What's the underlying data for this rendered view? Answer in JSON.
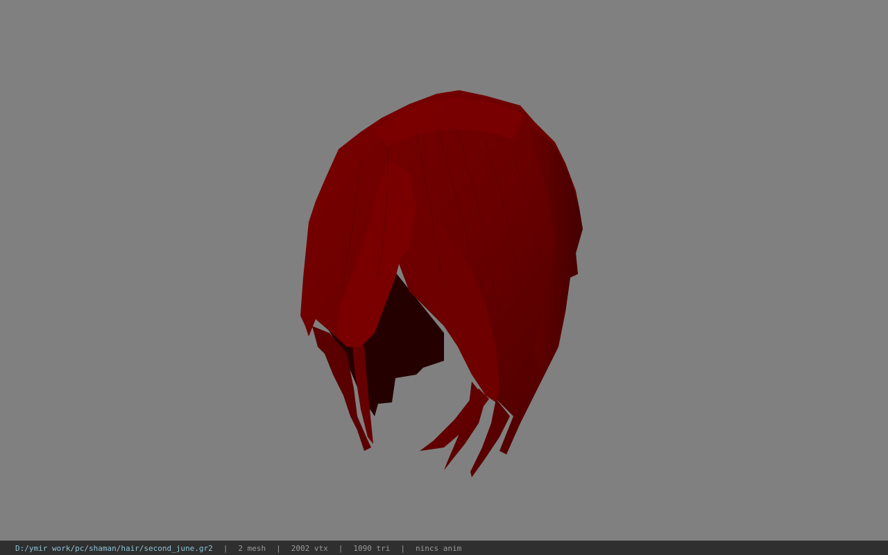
{
  "window": {
    "background_color": "#808080"
  },
  "viewport": {
    "model_name": "hair-mesh",
    "model_color": "#6e0000"
  },
  "statusbar": {
    "file_path": "D:/ymir work/pc/shaman/hair/second_june.gr2",
    "separator": "|",
    "mesh_count": "2 mesh",
    "vertex_count": "2002 vtx",
    "triangle_count": "1090 tri",
    "anim_status": "nincs anim",
    "path_color": "#8fc3d6",
    "text_color": "#9a9a9a"
  }
}
